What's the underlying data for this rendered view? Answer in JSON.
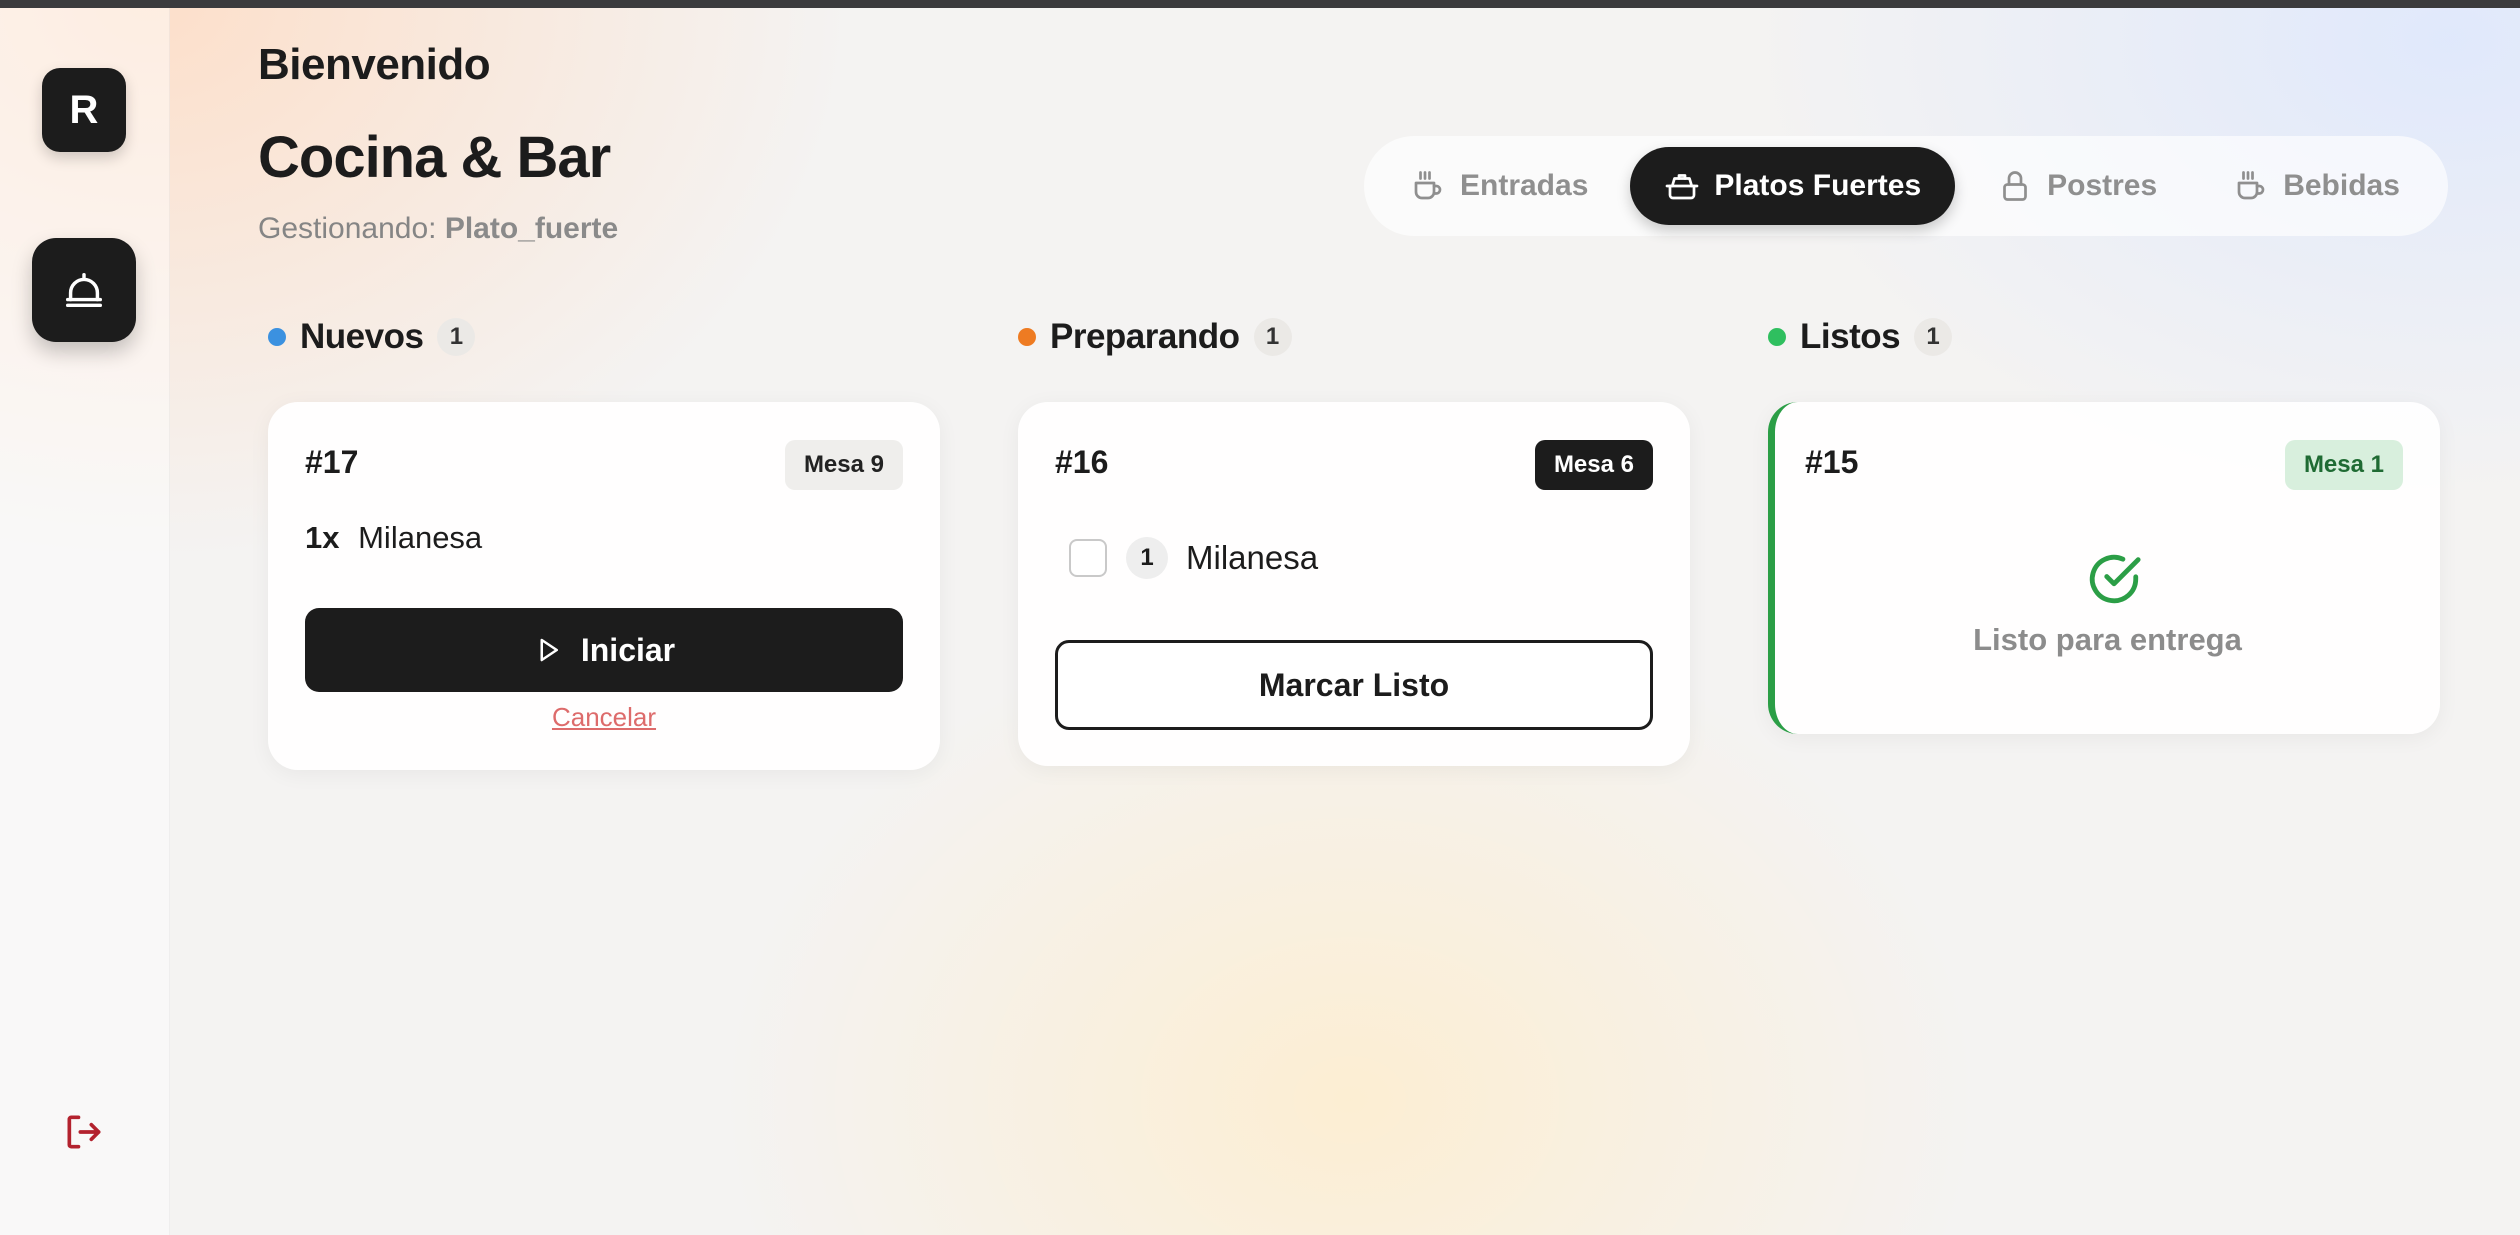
{
  "sidebar": {
    "logo_letter": "R",
    "icons": {
      "bell": "bell-icon",
      "logout": "logout-icon"
    }
  },
  "header": {
    "welcome": "Bienvenido",
    "title": "Cocina & Bar",
    "subtitle_prefix": "Gestionando:",
    "subtitle_value": "Plato_fuerte"
  },
  "tabs": [
    {
      "label": "Entradas",
      "icon": "coffee-cup-icon",
      "active": false
    },
    {
      "label": "Platos Fuertes",
      "icon": "cooking-pot-icon",
      "active": true
    },
    {
      "label": "Postres",
      "icon": "lock-icon",
      "active": false
    },
    {
      "label": "Bebidas",
      "icon": "coffee-cup-icon",
      "active": false
    }
  ],
  "columns": {
    "nuevos": {
      "title": "Nuevos",
      "count": "1",
      "color": "#3b91e0",
      "card": {
        "order": "#17",
        "mesa": "Mesa 9",
        "qty": "1x",
        "item": "Milanesa",
        "start_label": "Iniciar",
        "cancel_label": "Cancelar"
      }
    },
    "preparando": {
      "title": "Preparando",
      "count": "1",
      "color": "#ee7b22",
      "card": {
        "order": "#16",
        "mesa": "Mesa 6",
        "qty": "1",
        "item": "Milanesa",
        "ready_label": "Marcar Listo"
      }
    },
    "listos": {
      "title": "Listos",
      "count": "1",
      "color": "#2fbf5f",
      "card": {
        "order": "#15",
        "mesa": "Mesa 1",
        "status": "Listo para entrega"
      }
    }
  },
  "colors": {
    "dark": "#1c1c1c",
    "cancel": "#dd6b6b",
    "ready_accent": "#2b9e46",
    "ready_badge_bg": "#d8efdd",
    "ready_badge_text": "#1f6b33",
    "logout": "#b3222e"
  }
}
